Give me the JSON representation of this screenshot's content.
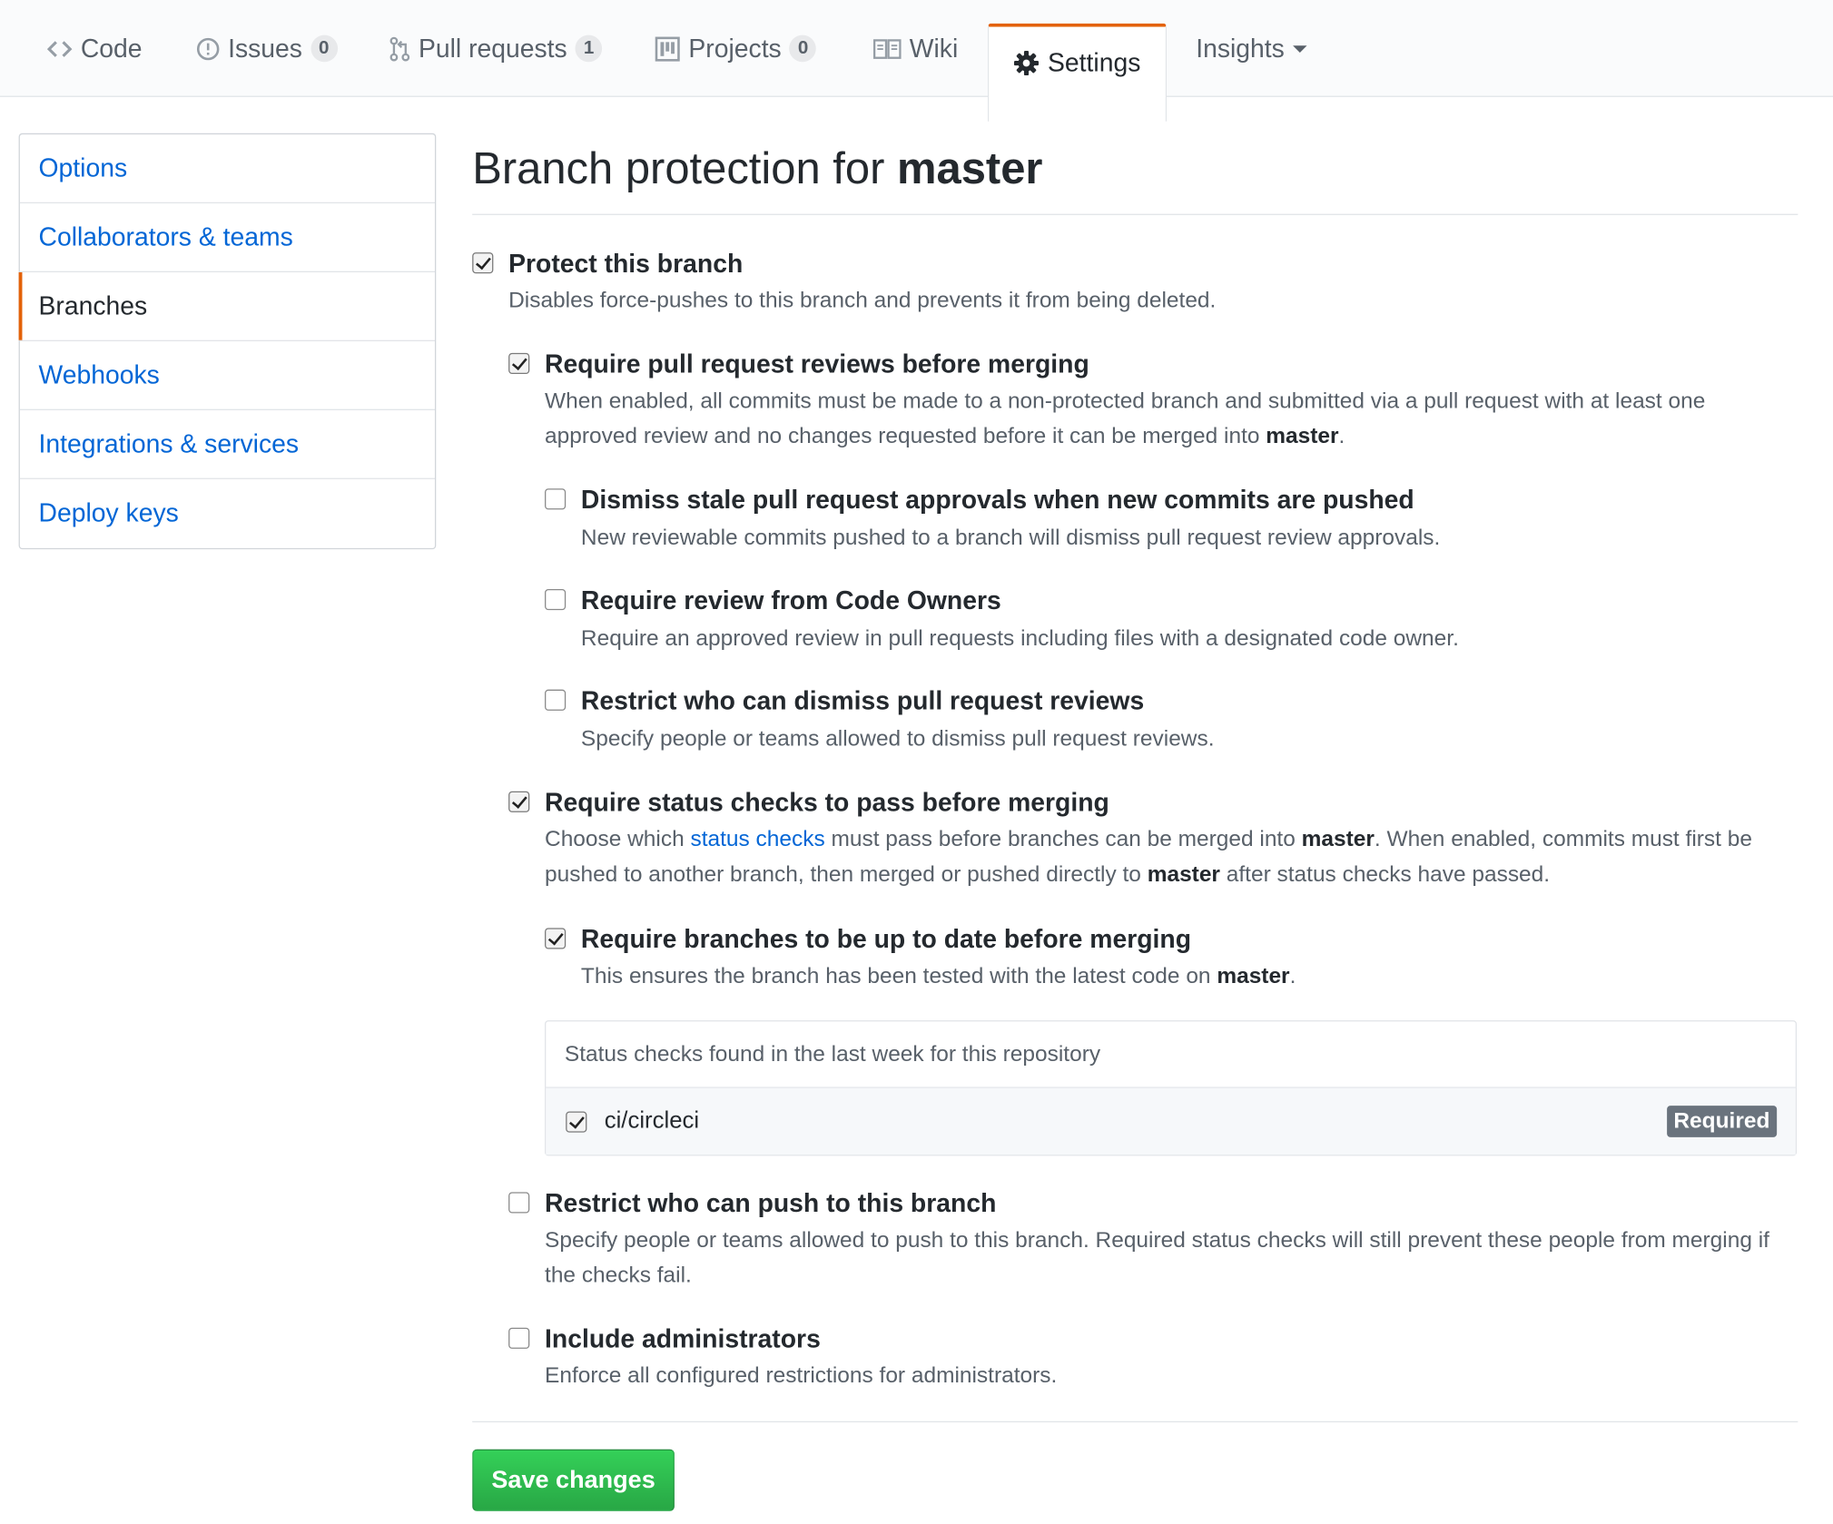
{
  "tabs": [
    {
      "label": "Code",
      "icon": "code-icon"
    },
    {
      "label": "Issues",
      "icon": "issue-opened-icon",
      "count": "0"
    },
    {
      "label": "Pull requests",
      "icon": "git-pull-request-icon",
      "count": "1"
    },
    {
      "label": "Projects",
      "icon": "project-icon",
      "count": "0"
    },
    {
      "label": "Wiki",
      "icon": "book-icon"
    },
    {
      "label": "Settings",
      "icon": "gear-icon",
      "selected": true
    },
    {
      "label": "Insights",
      "icon": "triangle-down-icon"
    }
  ],
  "sidebar": {
    "items": [
      {
        "label": "Options"
      },
      {
        "label": "Collaborators & teams"
      },
      {
        "label": "Branches",
        "selected": true
      },
      {
        "label": "Webhooks"
      },
      {
        "label": "Integrations & services"
      },
      {
        "label": "Deploy keys"
      }
    ]
  },
  "page": {
    "title_prefix": "Branch protection for ",
    "branch": "master"
  },
  "options": {
    "protect": {
      "label": "Protect this branch",
      "note": "Disables force-pushes to this branch and prevents it from being deleted.",
      "checked": true
    },
    "reviews": {
      "label": "Require pull request reviews before merging",
      "note_a": "When enabled, all commits must be made to a non-protected branch and submitted via a pull request with at least one approved review and no changes requested before it can be merged into ",
      "note_b": ".",
      "checked": true
    },
    "dismiss_stale": {
      "label": "Dismiss stale pull request approvals when new commits are pushed",
      "note": "New reviewable commits pushed to a branch will dismiss pull request review approvals.",
      "checked": false
    },
    "code_owners": {
      "label": "Require review from Code Owners",
      "note": "Require an approved review in pull requests including files with a designated code owner.",
      "checked": false
    },
    "restrict_dismiss": {
      "label": "Restrict who can dismiss pull request reviews",
      "note": "Specify people or teams allowed to dismiss pull request reviews.",
      "checked": false
    },
    "status_checks": {
      "label": "Require status checks to pass before merging",
      "note_a": "Choose which ",
      "note_link": "status checks",
      "note_b": " must pass before branches can be merged into ",
      "note_c": ". When enabled, commits must first be pushed to another branch, then merged or pushed directly to ",
      "note_d": " after status checks have passed.",
      "checked": true
    },
    "up_to_date": {
      "label": "Require branches to be up to date before merging",
      "note_a": "This ensures the branch has been tested with the latest code on ",
      "note_b": ".",
      "checked": true
    },
    "restrict_push": {
      "label": "Restrict who can push to this branch",
      "note": "Specify people or teams allowed to push to this branch. Required status checks will still prevent these people from merging if the checks fail.",
      "checked": false
    },
    "admins": {
      "label": "Include administrators",
      "note": "Enforce all configured restrictions for administrators.",
      "checked": false
    }
  },
  "status_box": {
    "header": "Status checks found in the last week for this repository",
    "checks": [
      {
        "name": "ci/circleci",
        "checked": true,
        "badge": "Required"
      }
    ]
  },
  "actions": {
    "save_label": "Save changes"
  },
  "colors": {
    "accent_orange": "#e36209",
    "link_blue": "#0366d6",
    "button_green": "#28a745"
  }
}
